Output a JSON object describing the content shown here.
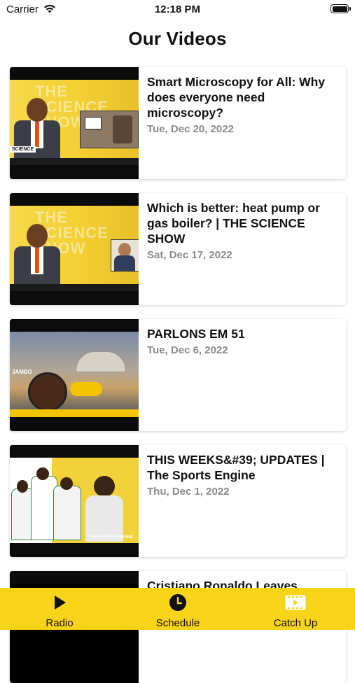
{
  "status_bar": {
    "carrier": "Carrier",
    "time": "12:18 PM"
  },
  "page": {
    "title": "Our Videos"
  },
  "videos": [
    {
      "title": "Smart Microscopy for All: Why does everyone need microscopy?",
      "date": "Tue, Dec 20, 2022",
      "thumbnail_watermark": "THE SCIENCE SHOW",
      "thumbnail_chip": "SCIENCE"
    },
    {
      "title": "Which is better: heat pump or gas boiler? | THE SCIENCE SHOW",
      "date": "Sat, Dec 17, 2022",
      "thumbnail_watermark": "THE SCIENCE SHOW"
    },
    {
      "title": "PARLONS EM 51",
      "date": "Tue, Dec 6, 2022",
      "thumbnail_chip": "JAMBO"
    },
    {
      "title": "THIS WEEKS&#39; UPDATES | The Sports Engine",
      "date": "Thu, Dec 1, 2022",
      "thumbnail_chip": "THE SPORTS ENGINE"
    },
    {
      "title": "Cristiano Ronaldo Leaves"
    }
  ],
  "tab_bar": {
    "tabs": [
      {
        "label": "Radio",
        "icon": "play-icon"
      },
      {
        "label": "Schedule",
        "icon": "clock-icon"
      },
      {
        "label": "Catch Up",
        "icon": "film-icon"
      }
    ]
  },
  "colors": {
    "accent": "#F7D31A",
    "date_gray": "#8A8A8A",
    "text": "#111111"
  }
}
